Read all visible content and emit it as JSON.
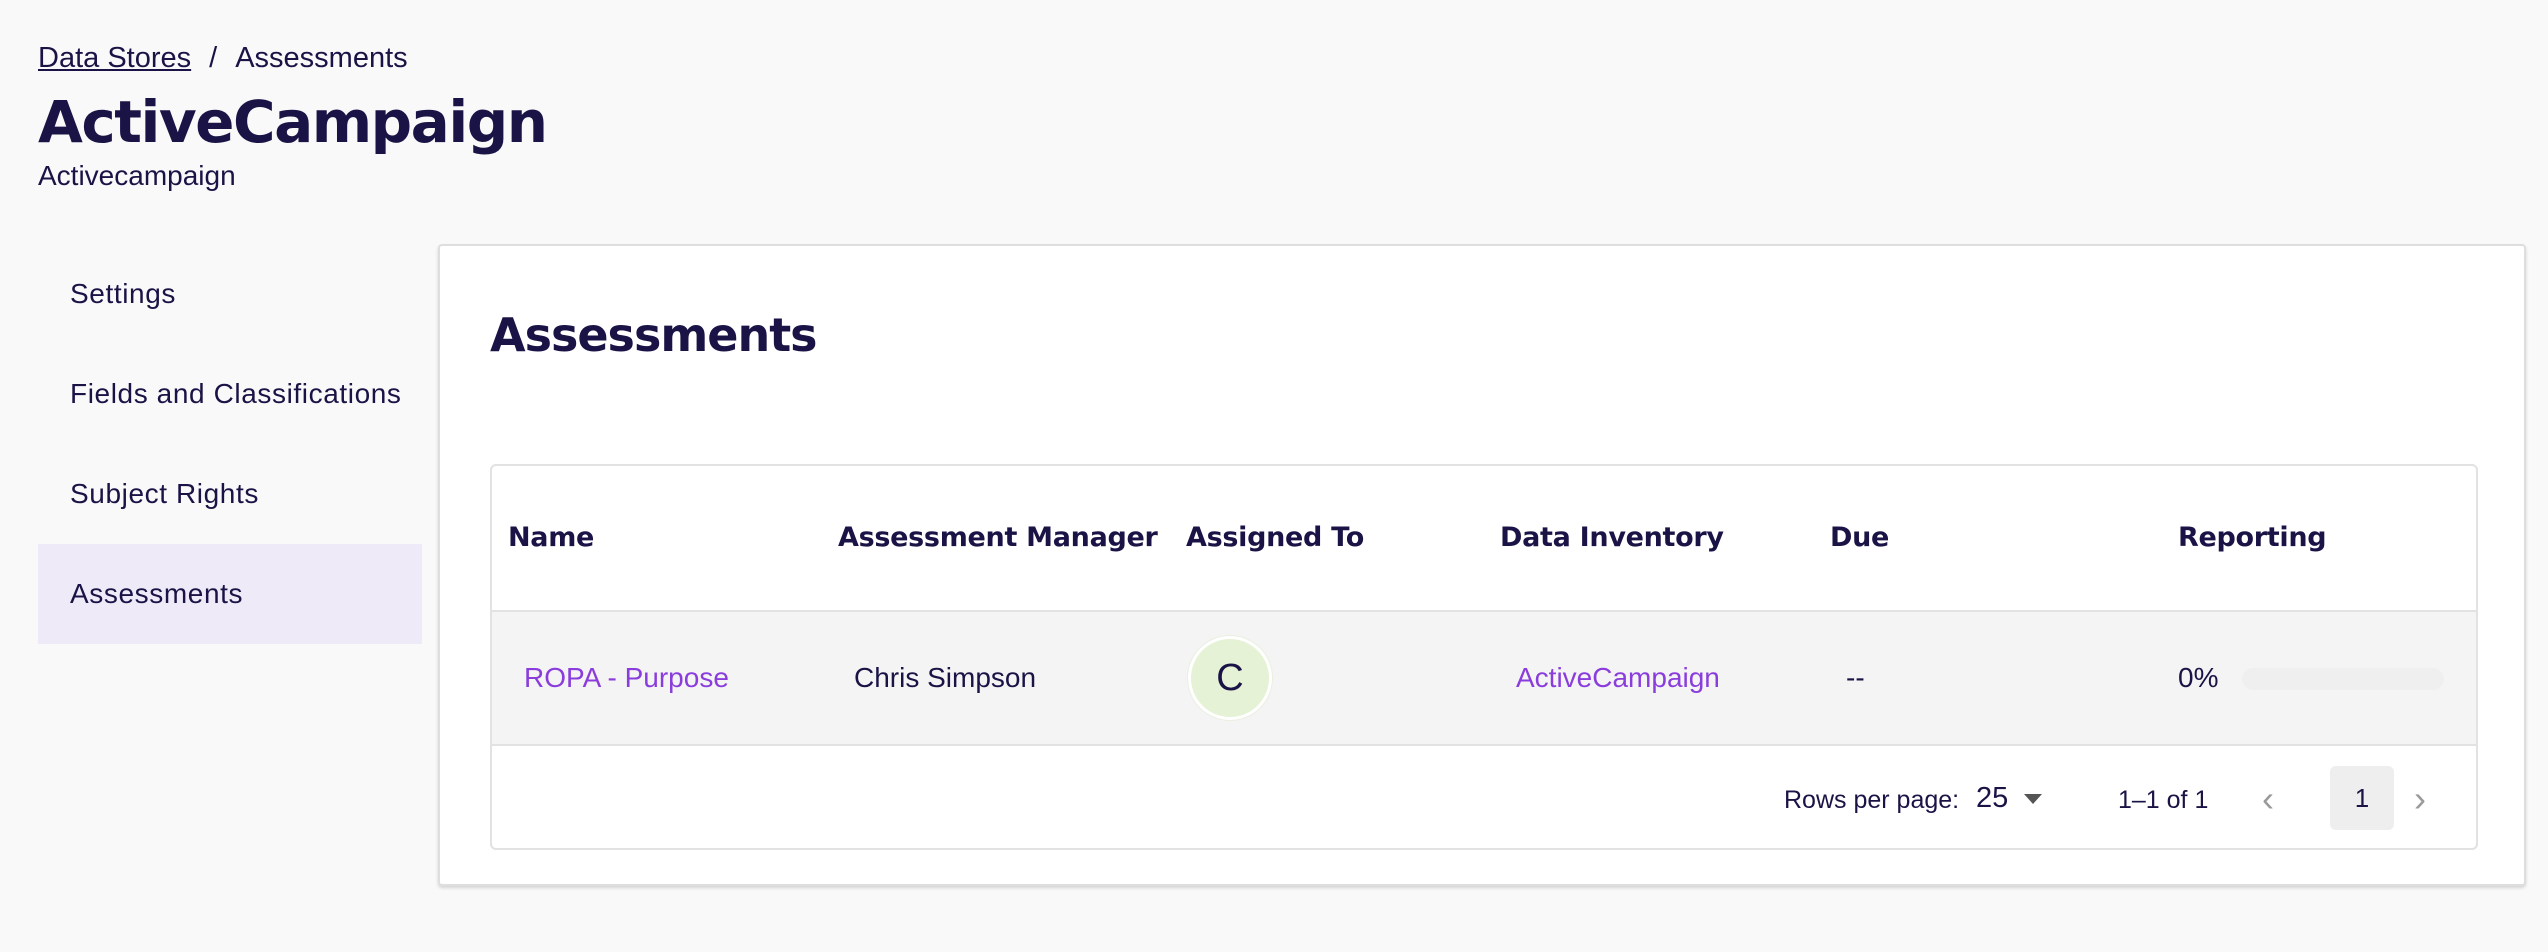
{
  "breadcrumb": {
    "parent": "Data Stores",
    "separator": "/",
    "current": "Assessments"
  },
  "header": {
    "title": "ActiveCampaign",
    "subtitle": "Activecampaign"
  },
  "sidebar": {
    "items": [
      {
        "label": "Settings",
        "active": false
      },
      {
        "label": "Fields and Classifications",
        "active": false
      },
      {
        "label": "Subject Rights",
        "active": false
      },
      {
        "label": "Assessments",
        "active": true
      }
    ]
  },
  "main": {
    "title": "Assessments",
    "table": {
      "columns": [
        "Name",
        "Assessment Manager",
        "Assigned To",
        "Data Inventory",
        "Due",
        "Reporting"
      ],
      "rows": [
        {
          "name": "ROPA - Purpose",
          "manager": "Chris Simpson",
          "assigned_initial": "C",
          "data_inventory": "ActiveCampaign",
          "due": "--",
          "reporting_label": "0%",
          "reporting_progress": 0
        }
      ]
    },
    "pagination": {
      "rows_per_page_label": "Rows per page:",
      "rows_per_page_value": "25",
      "range": "1–1 of 1",
      "current_page": "1",
      "prev_icon": "‹",
      "next_icon": "›"
    }
  },
  "colors": {
    "brand_navy": "#1a1446",
    "link_purple": "#8a3ddc",
    "active_nav_bg": "#efeaf8",
    "avatar_bg": "#e6f2d6"
  }
}
